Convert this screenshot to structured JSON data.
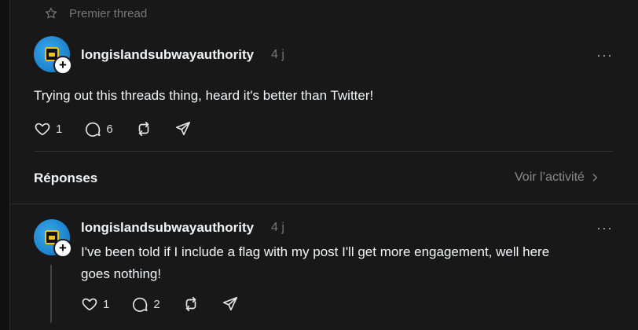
{
  "pinned_label": "Premier thread",
  "post": {
    "username": "longislandsubwayauthority",
    "time": "4 j",
    "text": "Trying out this threads thing, heard it's better than Twitter!",
    "likes": "1",
    "comments": "6"
  },
  "replies_section": {
    "title": "Réponses",
    "activity_link": "Voir l’activité"
  },
  "reply": {
    "username": "longislandsubwayauthority",
    "time": "4 j",
    "text_line1": "I've been told if I include a flag with my post I'll get more engagement, well here",
    "text_line2": "goes nothing!",
    "likes": "1",
    "comments": "2"
  },
  "more_glyph": "···",
  "icons": [
    "star-icon",
    "heart-icon",
    "comment-icon",
    "repost-icon",
    "share-icon",
    "more-icon",
    "chevron-right-icon",
    "plus-icon"
  ]
}
